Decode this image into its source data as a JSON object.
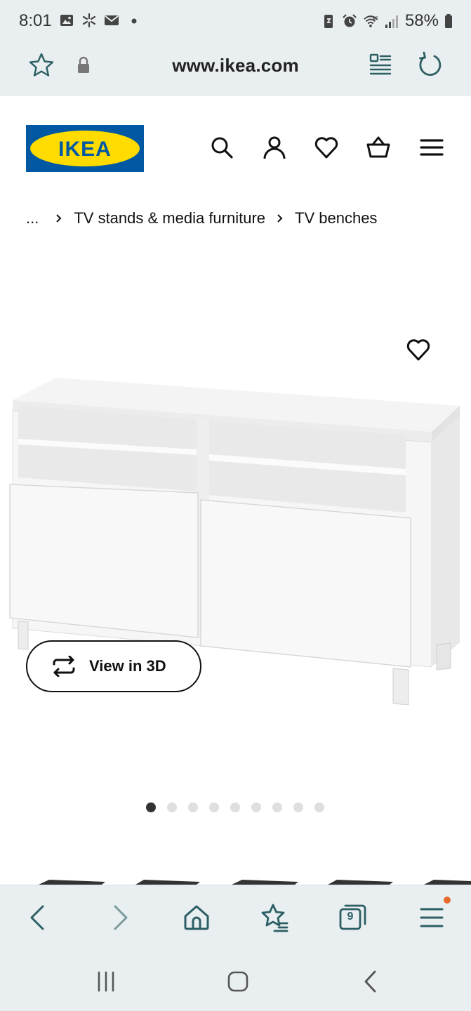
{
  "status": {
    "time": "8:01",
    "battery": "58%",
    "network": "6E",
    "left_icons": [
      "image-icon",
      "sparkle-icon",
      "mail-icon",
      "dot-icon"
    ],
    "right_icons": [
      "battery-saver-icon",
      "alarm-icon",
      "wifi-icon",
      "signal-icon",
      "battery-icon"
    ]
  },
  "browser": {
    "url": "www.ikea.com",
    "tab_count": "9",
    "accent": "#2c5f63",
    "notification_color": "#e8692c"
  },
  "brand": {
    "logo_text": "IKEA",
    "blue": "#0058a3",
    "yellow": "#ffdb00"
  },
  "header_icons": [
    "search-icon",
    "account-icon",
    "heart-icon",
    "basket-icon",
    "menu-icon"
  ],
  "breadcrumb": {
    "ellipsis": "...",
    "items": [
      "TV stands & media furniture",
      "TV benches"
    ]
  },
  "product": {
    "view3d_label": "View in 3D",
    "image_count": 9,
    "active_image": 1
  }
}
